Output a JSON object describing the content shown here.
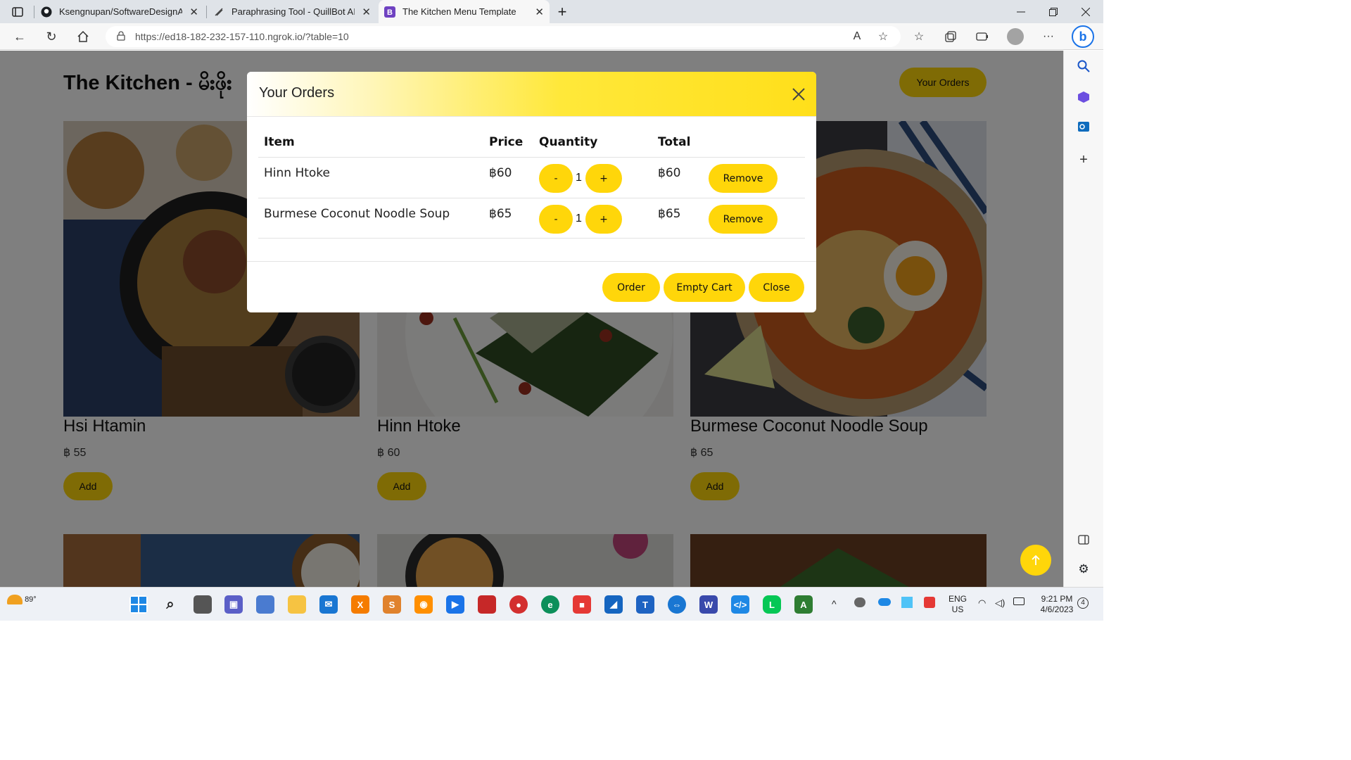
{
  "browser": {
    "tabs": [
      {
        "title": "Ksengnupan/SoftwareDesignAlo",
        "icon": "github-icon"
      },
      {
        "title": "Paraphrasing Tool - QuillBot AI",
        "icon": "quillbot-icon"
      },
      {
        "title": "The Kitchen Menu Template",
        "icon": "bootstrap-icon",
        "active": true
      }
    ],
    "url": "https://ed18-182-232-157-110.ngrok.io/?table=10"
  },
  "page": {
    "site_title": "The Kitchen - မိးဖိုး",
    "your_orders_button": "Your Orders",
    "menu_items": [
      {
        "name": "Hsi Htamin",
        "price": "฿ 55",
        "add_label": "Add"
      },
      {
        "name": "Hinn Htoke",
        "price": "฿ 60",
        "add_label": "Add"
      },
      {
        "name": "Burmese Coconut Noodle Soup",
        "price": "฿ 65",
        "add_label": "Add"
      }
    ]
  },
  "modal": {
    "title": "Your Orders",
    "headers": {
      "item": "Item",
      "price": "Price",
      "quantity": "Quantity",
      "total": "Total"
    },
    "rows": [
      {
        "item": "Hinn Htoke",
        "price": "฿60",
        "minus": "-",
        "quantity": "1",
        "plus": "+",
        "total": "฿60",
        "remove": "Remove"
      },
      {
        "item": "Burmese Coconut Noodle Soup",
        "price": "฿65",
        "minus": "-",
        "quantity": "1",
        "plus": "+",
        "total": "฿65",
        "remove": "Remove"
      }
    ],
    "footer": {
      "order": "Order",
      "empty_cart": "Empty Cart",
      "close": "Close"
    }
  },
  "taskbar": {
    "weather": "89°",
    "language": "ENG",
    "region": "US",
    "time": "9:21 PM",
    "date": "4/6/2023",
    "notification_count": "4"
  },
  "colors": {
    "accent": "#ffd60a",
    "backdrop": "rgba(0,0,0,0.5)"
  }
}
